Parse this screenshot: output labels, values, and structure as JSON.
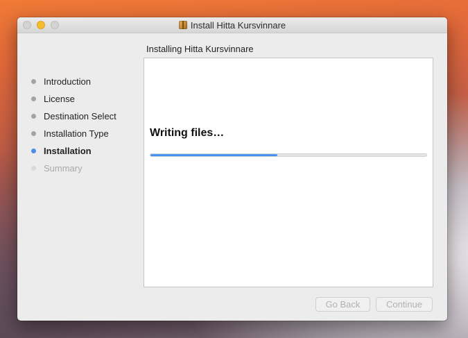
{
  "window": {
    "title": "Install Hitta Kursvinnare",
    "app_icon": "package-icon"
  },
  "sidebar": {
    "steps": [
      {
        "label": "Introduction",
        "state": "done"
      },
      {
        "label": "License",
        "state": "done"
      },
      {
        "label": "Destination Select",
        "state": "done"
      },
      {
        "label": "Installation Type",
        "state": "done"
      },
      {
        "label": "Installation",
        "state": "active"
      },
      {
        "label": "Summary",
        "state": "future"
      }
    ]
  },
  "main": {
    "subtitle": "Installing Hitta Kursvinnare",
    "status": "Writing files…",
    "progress": 0.46
  },
  "buttons": {
    "back": "Go Back",
    "continue": "Continue"
  },
  "colors": {
    "accent": "#3a86ea",
    "done_dot": "#a3a3a3",
    "active_dot": "#4a90e8",
    "future_dot": "#d9d9d9",
    "minimize_light": "#f5bd2e"
  }
}
